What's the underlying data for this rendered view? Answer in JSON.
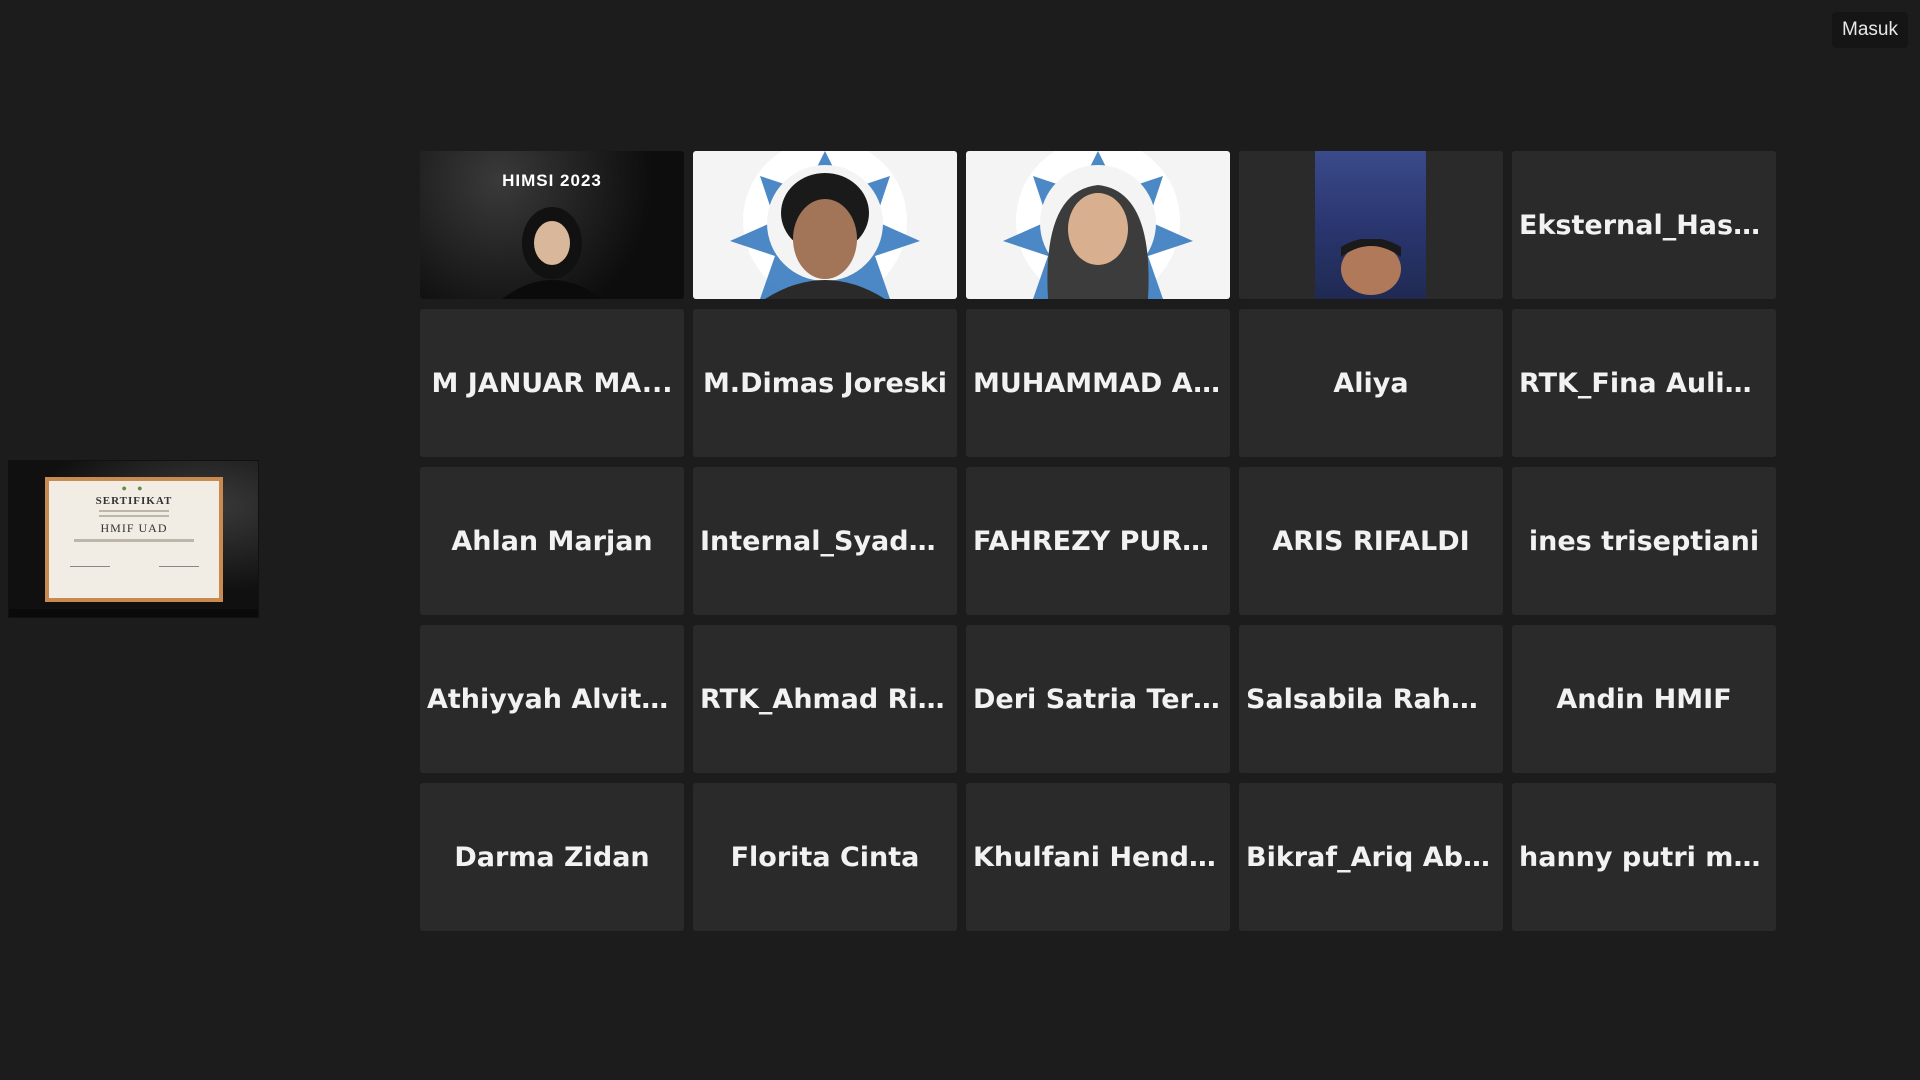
{
  "top_label": "Masuk",
  "shared_screen": {
    "certificate": {
      "title": "SERTIFIKAT",
      "organization": "HMIF UAD",
      "logos_icon": "org-logos-icon",
      "signature_icon": "signature-icon"
    }
  },
  "video_tiles": [
    {
      "banner": "HIMSI 2023",
      "icon": "person-avatar-hijab-icon"
    },
    {
      "icon": "person-avatar-icon"
    },
    {
      "icon": "person-avatar-hijab-icon"
    },
    {
      "icon": "person-avatar-icon"
    }
  ],
  "participants": [
    "Eksternal_Hasya Z",
    "M JANUAR MA...",
    "M.Dimas Joreski",
    "MUHAMMAD A...",
    "Aliya",
    "RTK_Fina Aulia...",
    "Ahlan Marjan",
    "Internal_Syadza...",
    "FAHREZY PURBA",
    "ARIS RIFALDI",
    "ines triseptiani",
    "Athiyyah Alvita...",
    "RTK_Ahmad Rif...",
    "Deri Satria Tern...",
    "Salsabila Rahmah",
    "Andin HMIF",
    "Darma Zidan",
    "Florita Cinta",
    "Khulfani Hendr...",
    "Bikraf_Ariq Abd...",
    "hanny putri ma..."
  ],
  "colors": {
    "background": "#1c1c1c",
    "tile": "#2a2a2a",
    "text": "#f2f2f2"
  }
}
